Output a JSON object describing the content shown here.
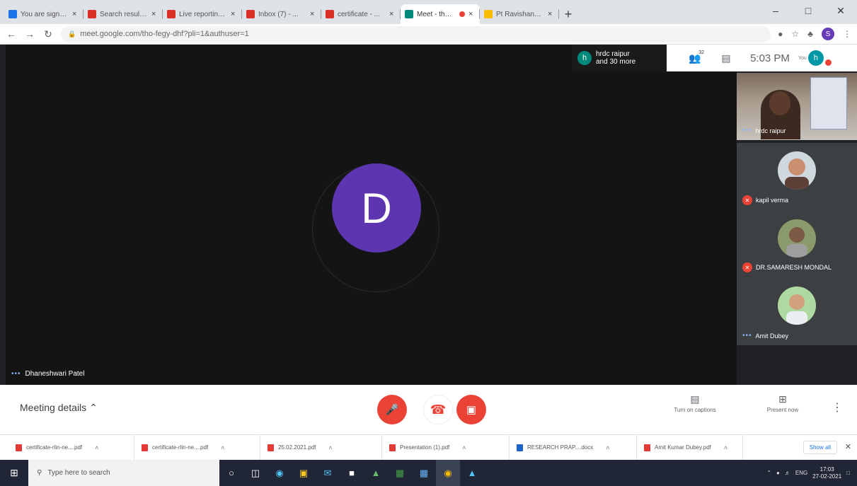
{
  "browser": {
    "tabs": [
      {
        "title": "You are signed in as ...",
        "favicon_color": "#1a73e8",
        "active": false,
        "recording": false
      },
      {
        "title": "Search results - ...",
        "favicon_color": "#d93025",
        "active": false,
        "recording": false
      },
      {
        "title": "Live reporting ...",
        "favicon_color": "#d93025",
        "active": false,
        "recording": false
      },
      {
        "title": "Inbox (7) - ...",
        "favicon_color": "#d93025",
        "active": false,
        "recording": false
      },
      {
        "title": "certificate - ...",
        "favicon_color": "#d93025",
        "active": false,
        "recording": false
      },
      {
        "title": "Meet - tho-fegy-...",
        "favicon_color": "#00897b",
        "active": true,
        "recording": true
      },
      {
        "title": "Pt Ravishankar Shukla ...",
        "favicon_color": "#fbbc04",
        "active": false,
        "recording": false
      }
    ],
    "url": "meet.google.com/tho-fegy-dhf?pli=1&authuser=1",
    "profile_initial": "S"
  },
  "meet": {
    "main_speaker": {
      "initial": "D",
      "name": "Dhaneshwari Patel"
    },
    "participant_chip": {
      "initial": "h",
      "line1": "hrdc raipur",
      "line2": "and 30 more"
    },
    "participants_count": "32",
    "time": "5:03 PM",
    "you_label": "You",
    "self_initial": "h",
    "sidebar": [
      {
        "name": "hrdc raipur",
        "muted": false,
        "video": true
      },
      {
        "name": "kapil verma",
        "muted": true,
        "video": false
      },
      {
        "name": "DR.SAMARESH MONDAL",
        "muted": true,
        "video": false
      },
      {
        "name": "Amit Dubey",
        "muted": false,
        "video": false
      }
    ],
    "meeting_details": "Meeting details",
    "captions_label": "Turn on captions",
    "present_label": "Present now"
  },
  "downloads": [
    {
      "name": "certificate-rlin-ne....pdf",
      "type": "pdf"
    },
    {
      "name": "certificate-rlin-ne....pdf",
      "type": "pdf"
    },
    {
      "name": "25.02.2021.pdf",
      "type": "pdf"
    },
    {
      "name": "Presentation (1).pdf",
      "type": "pdf"
    },
    {
      "name": "RESEARCH PRAP....docx",
      "type": "doc"
    },
    {
      "name": "Amit Kumar Dubey.pdf",
      "type": "pdf"
    }
  ],
  "downloads_show_all": "Show all",
  "taskbar": {
    "search_placeholder": "Type here to search",
    "lang": "ENG",
    "time": "17:03",
    "date": "27-02-2021"
  }
}
